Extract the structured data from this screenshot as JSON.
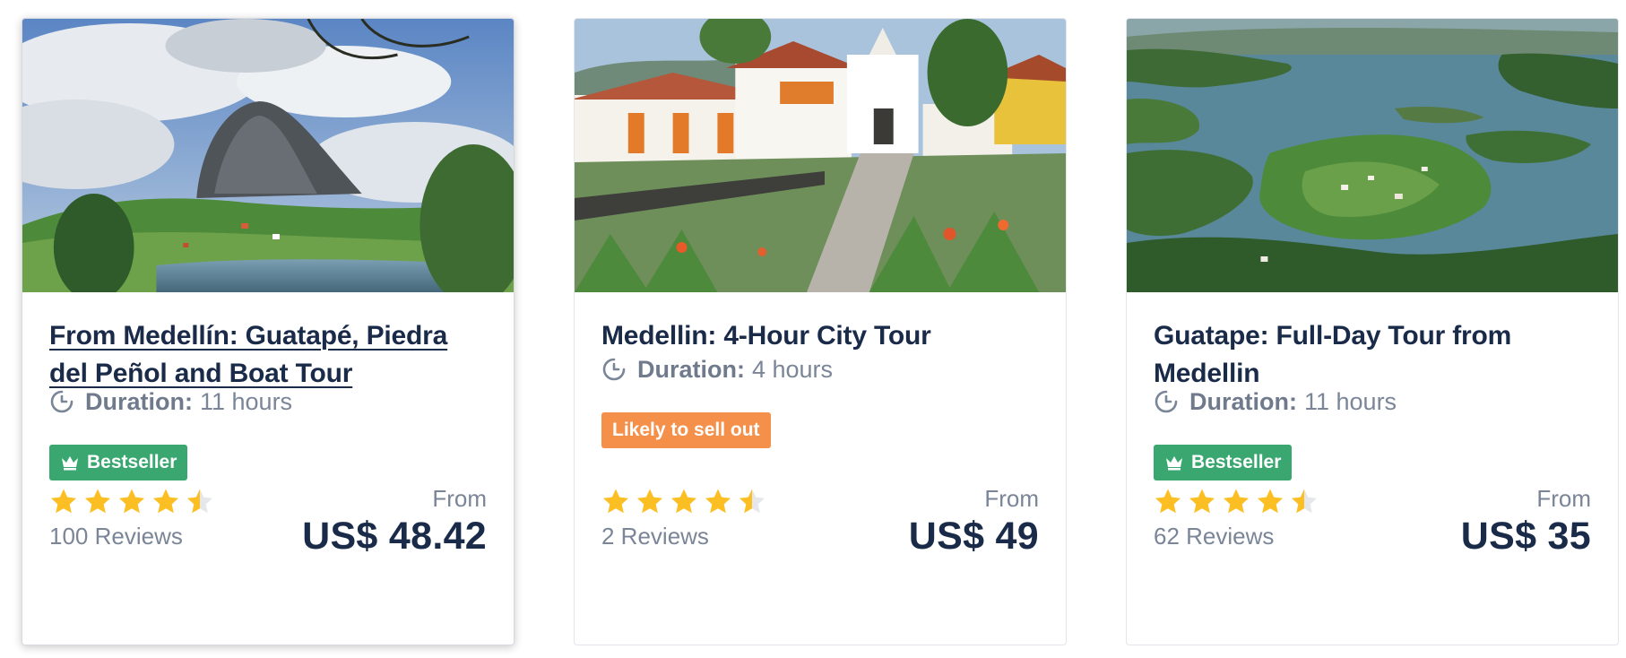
{
  "colors": {
    "title": "#1a2b49",
    "muted": "#7a8597",
    "star": "#fbbf24",
    "star_empty": "#e5e7eb",
    "bestseller": "#3aa770",
    "likely": "#f5904a"
  },
  "cards": [
    {
      "title": "From Medellín: Guatapé, Piedra del Peñol and Boat Tour",
      "duration_label": "Duration:",
      "duration_value": "11 hours",
      "badge": "Bestseller",
      "badge_icon": "crown-icon",
      "rating": 4.5,
      "reviews": "100 Reviews",
      "from_label": "From",
      "price": "US$ 48.42"
    },
    {
      "title": "Medellin: 4-Hour City Tour",
      "duration_label": "Duration:",
      "duration_value": "4 hours",
      "badge": "Likely to sell out",
      "rating": 4.5,
      "reviews": "2 Reviews",
      "from_label": "From",
      "price": "US$ 49"
    },
    {
      "title": "Guatape: Full-Day Tour from Medellin",
      "duration_label": "Duration:",
      "duration_value": "11 hours",
      "badge": "Bestseller",
      "badge_icon": "crown-icon",
      "rating": 4.5,
      "reviews": "62 Reviews",
      "from_label": "From",
      "price": "US$ 35"
    }
  ]
}
